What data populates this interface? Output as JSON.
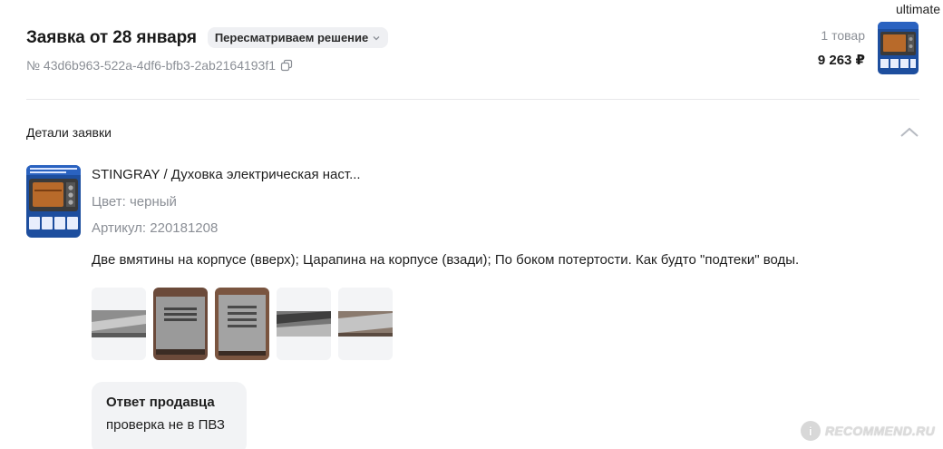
{
  "watermark": {
    "top_text": "ultimate",
    "bottom_text": "RECOMMEND.RU",
    "bottom_logo": "i"
  },
  "header": {
    "title": "Заявка от 28 января",
    "status": "Пересматриваем решение",
    "order_id": "№ 43d6b963-522a-4df6-bfb3-2ab2164193f1"
  },
  "summary": {
    "count": "1 товар",
    "price": "9 263 ₽"
  },
  "details": {
    "title": "Детали заявки"
  },
  "product": {
    "name": "STINGRAY / Духовка электрическая наст...",
    "color": "Цвет: черный",
    "sku": "Артикул: 220181208"
  },
  "defect_description": "Две вмятины на корпусе (вверх); Царапина на корпусе (взади); По боком потертости. Как будто \"подтеки\" воды.",
  "photos_count": 5,
  "seller_reply": {
    "title": "Ответ продавца",
    "text": "проверка не в ПВЗ"
  },
  "colors": {
    "badge_bg": "#eff0f3",
    "muted_text": "#8b8f96",
    "reply_bg": "#f2f3f5",
    "product_blue": "#1d4e9e"
  }
}
